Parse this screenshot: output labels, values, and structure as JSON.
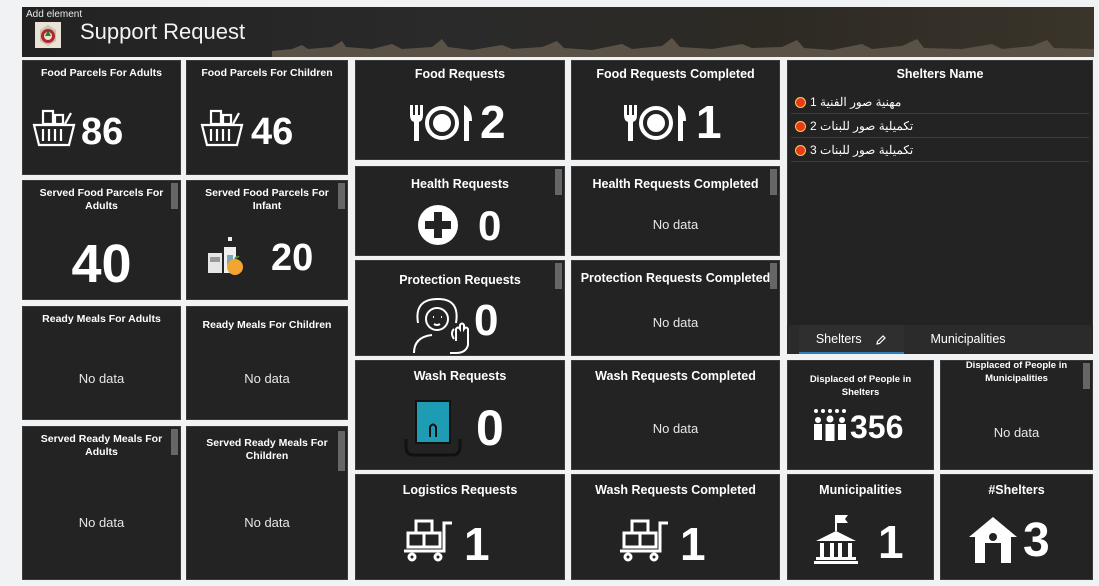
{
  "header": {
    "add_element": "Add element",
    "title": "Support Request"
  },
  "panels": {
    "food_adults": {
      "title": "Food Parcels For Adults",
      "value": "86"
    },
    "food_children": {
      "title": "Food Parcels For Children",
      "value": "46"
    },
    "served_food_adults": {
      "title": "Served Food Parcels For Adults",
      "value": "40"
    },
    "served_food_infant": {
      "title": "Served Food Parcels For Infant",
      "value": "20"
    },
    "ready_adults": {
      "title": "Ready Meals For Adults",
      "value": "No data"
    },
    "ready_children": {
      "title": "Ready Meals For Children",
      "value": "No data"
    },
    "served_ready_adults": {
      "title": "Served Ready Meals For Adults",
      "value": "No data"
    },
    "served_ready_children": {
      "title": "Served Ready Meals For Children",
      "value": "No data"
    },
    "food_requests": {
      "title": "Food Requests",
      "value": "2"
    },
    "food_completed": {
      "title": "Food Requests Completed",
      "value": "1"
    },
    "health_requests": {
      "title": "Health Requests",
      "value": "0"
    },
    "health_completed": {
      "title": "Health Requests Completed",
      "value": "No data"
    },
    "protection_requests": {
      "title": "Protection Requests",
      "value": "0"
    },
    "protection_completed": {
      "title": "Protection Requests Completed",
      "value": "No data"
    },
    "wash_requests": {
      "title": "Wash Requests",
      "value": "0"
    },
    "wash_completed": {
      "title": "Wash Requests Completed",
      "value": "No data"
    },
    "logistics_requests": {
      "title": "Logistics Requests",
      "value": "1"
    },
    "wash_completed_2": {
      "title": "Wash Requests Completed",
      "value": "1"
    },
    "displaced_shelters": {
      "title": "Displaced of People in Shelters",
      "value": "356"
    },
    "displaced_municipalities": {
      "title": "Displaced of People in Municipalities",
      "value": "No data"
    },
    "municipalities": {
      "title": "Municipalities",
      "value": "1"
    },
    "shelters_count": {
      "title": "#Shelters",
      "value": "3"
    }
  },
  "shelters_list": {
    "title": "Shelters Name",
    "items": [
      "مهنية صور الفنية 1",
      "تكميلية صور للبنات 2",
      "تكميلية صور للبنات 3"
    ]
  },
  "tabs": {
    "shelters": "Shelters",
    "municipalities": "Municipalities"
  },
  "colors": {
    "panel_bg": "#232323",
    "page_bg": "#f1f2f4",
    "accent_tab": "#2f7dbf",
    "dot_fill": "#e8391b",
    "wash_icon": "#1e9cb4",
    "orange_fruit": "#f2a531"
  },
  "icons": {
    "basket": "basket-icon",
    "cutlery": "cutlery-plate-icon",
    "health": "health-plus-icon",
    "protection": "woman-stop-hand-icon",
    "wash": "wash-station-icon",
    "cart": "cart-boxes-icon",
    "people": "people-group-icon",
    "building": "government-building-icon",
    "shelter": "shelter-house-icon",
    "infant_food": "infant-food-icon",
    "pencil": "pencil-icon"
  }
}
